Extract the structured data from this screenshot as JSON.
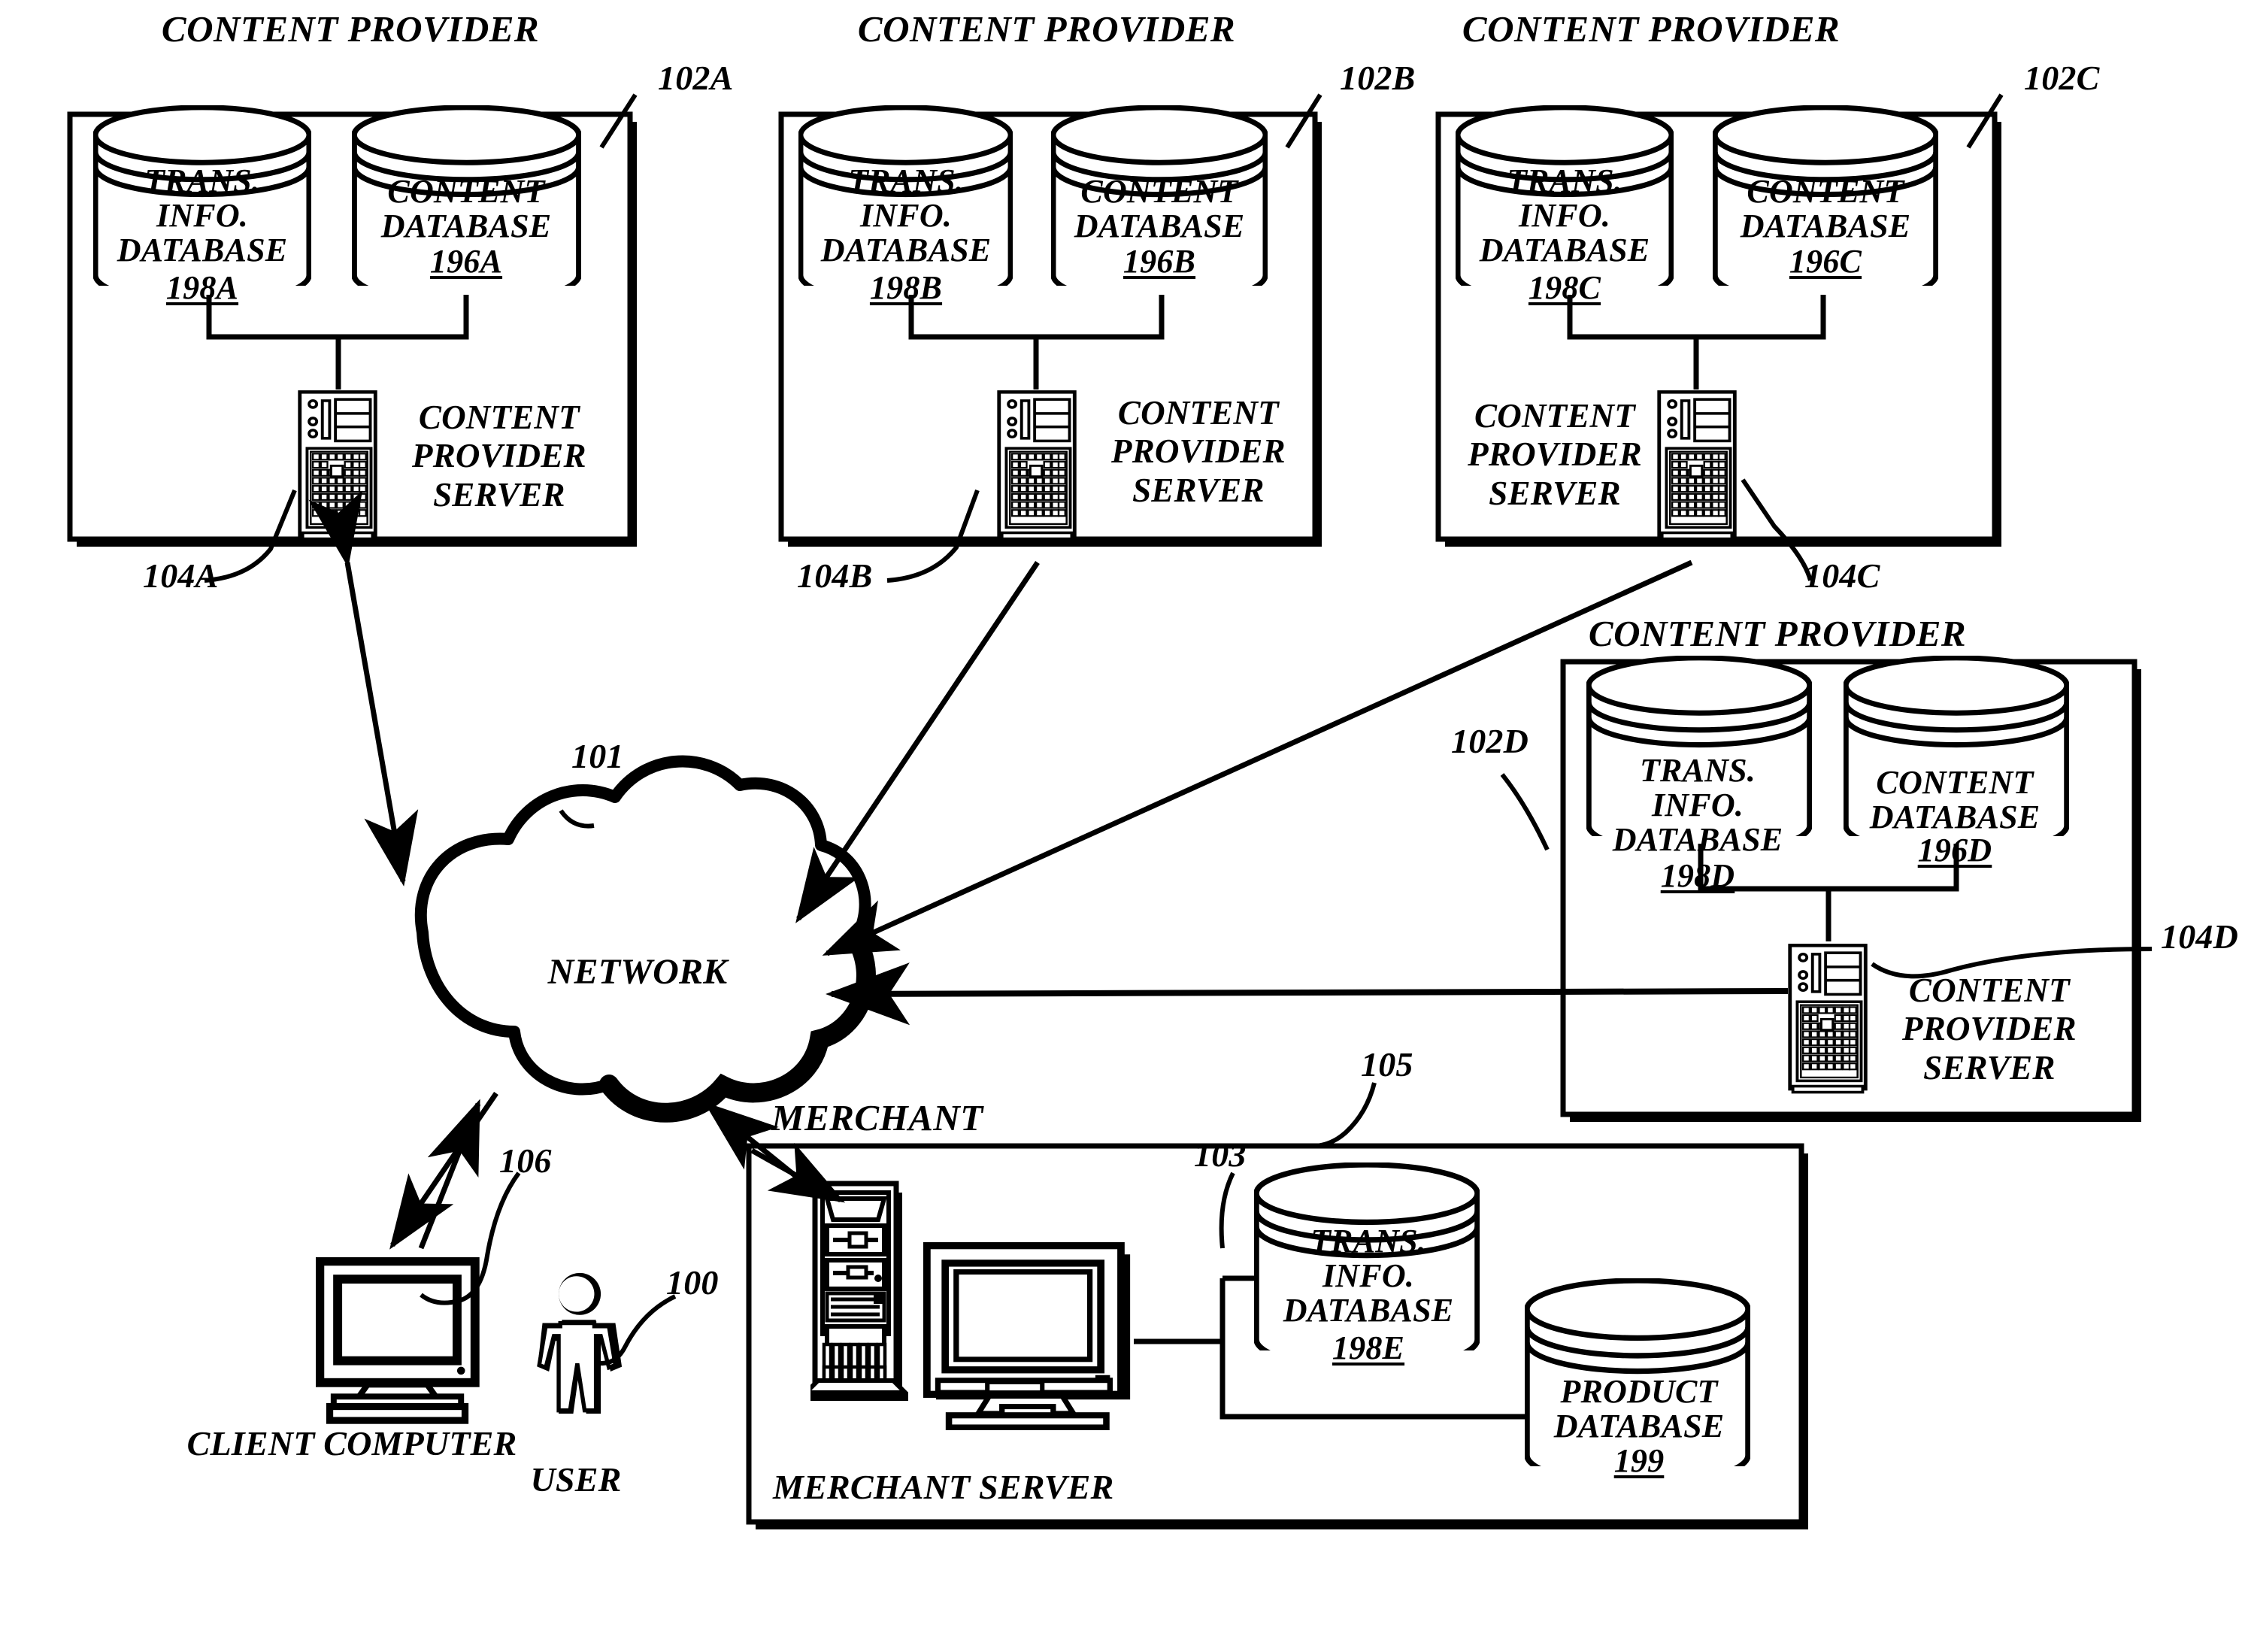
{
  "figure": {
    "type": "patent-network-architecture-diagram",
    "background": "#ffffff",
    "ink": "#000000"
  },
  "providers": [
    {
      "id": "A",
      "header": "CONTENT PROVIDER",
      "box_ref": "102A",
      "server_ref": "104A",
      "server_label": "CONTENT\nPROVIDER\nSERVER",
      "server_label_side": "right",
      "databases": [
        {
          "name": "TRANS.\nINFO.\nDATABASE",
          "ref": "198A"
        },
        {
          "name": "CONTENT\nDATABASE",
          "ref": "196A"
        }
      ]
    },
    {
      "id": "B",
      "header": "CONTENT PROVIDER",
      "box_ref": "102B",
      "server_ref": "104B",
      "server_label": "CONTENT\nPROVIDER\nSERVER",
      "server_label_side": "right",
      "databases": [
        {
          "name": "TRANS.\nINFO.\nDATABASE",
          "ref": "198B"
        },
        {
          "name": "CONTENT\nDATABASE",
          "ref": "196B"
        }
      ]
    },
    {
      "id": "C",
      "header": "CONTENT PROVIDER",
      "box_ref": "102C",
      "server_ref": "104C",
      "server_label": "CONTENT\nPROVIDER\nSERVER",
      "server_label_side": "left",
      "databases": [
        {
          "name": "TRANS.\nINFO.\nDATABASE",
          "ref": "198C"
        },
        {
          "name": "CONTENT\nDATABASE",
          "ref": "196C"
        }
      ]
    },
    {
      "id": "D",
      "header": "CONTENT PROVIDER",
      "box_ref": "102D",
      "server_ref": "104D",
      "server_label": "CONTENT\nPROVIDER\nSERVER",
      "server_label_side": "right",
      "databases": [
        {
          "name": "TRANS.\nINFO.\nDATABASE",
          "ref": "198D"
        },
        {
          "name": "CONTENT\nDATABASE",
          "ref": "196D"
        }
      ]
    }
  ],
  "network": {
    "label": "NETWORK",
    "ref": "101",
    "shape": "cloud"
  },
  "client": {
    "label": "CLIENT COMPUTER",
    "ref": "106",
    "icon": "crt-monitor"
  },
  "user": {
    "label": "USER",
    "ref": "100",
    "icon": "person-figure"
  },
  "merchant": {
    "header": "MERCHANT",
    "server_label": "MERCHANT SERVER",
    "server_ref": "103",
    "db_ref": "105",
    "databases": [
      {
        "name": "TRANS.\nINFO.\nDATABASE",
        "ref": "198E"
      },
      {
        "name": "PRODUCT\nDATABASE",
        "ref": "199"
      }
    ]
  }
}
